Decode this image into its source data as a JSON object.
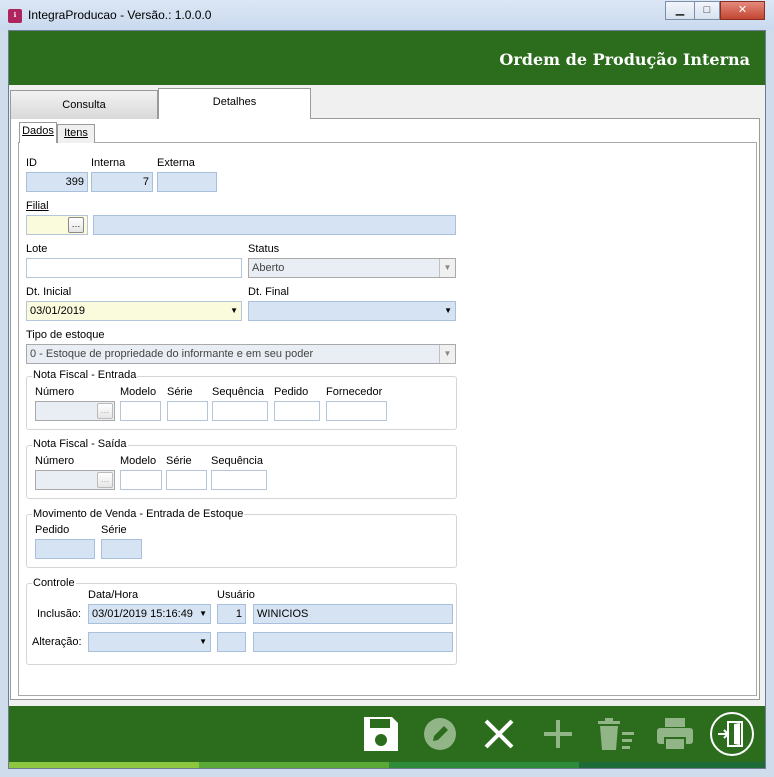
{
  "window": {
    "title": "IntegraProducao - Versão.: 1.0.0.0",
    "icon": "app-icon"
  },
  "header": {
    "title": "Ordem de Produção Interna"
  },
  "tabs": [
    {
      "label": "Consulta"
    },
    {
      "label": "Detalhes"
    }
  ],
  "subtabs": [
    {
      "label": "Dados"
    },
    {
      "label": "Itens"
    }
  ],
  "form": {
    "id_label": "ID",
    "id_value": "399",
    "interna_label": "Interna",
    "interna_value": "7",
    "externa_label": "Externa",
    "externa_value": "",
    "filial_label": "Filial",
    "filial_code": "",
    "filial_name": "",
    "lote_label": "Lote",
    "lote_value": "",
    "status_label": "Status",
    "status_value": "Aberto",
    "dt_inicial_label": "Dt. Inicial",
    "dt_inicial_value": "03/01/2019",
    "dt_final_label": "Dt. Final",
    "dt_final_value": "",
    "tipo_estoque_label": "Tipo de estoque",
    "tipo_estoque_value": "0 - Estoque de propriedade do informante e em seu poder"
  },
  "nf_entrada": {
    "title": "Nota Fiscal - Entrada",
    "labels": {
      "numero": "Número",
      "modelo": "Modelo",
      "serie": "Série",
      "sequencia": "Sequência",
      "pedido": "Pedido",
      "fornecedor": "Fornecedor"
    }
  },
  "nf_saida": {
    "title": "Nota Fiscal - Saída",
    "labels": {
      "numero": "Número",
      "modelo": "Modelo",
      "serie": "Série",
      "sequencia": "Sequência"
    }
  },
  "mov_venda": {
    "title": "Movimento de Venda - Entrada de Estoque",
    "labels": {
      "pedido": "Pedido",
      "serie": "Série"
    }
  },
  "controle": {
    "title": "Controle",
    "col_datahora": "Data/Hora",
    "col_usuario": "Usuário",
    "inclusao_label": "Inclusão:",
    "inclusao_datahora": "03/01/2019 15:16:49",
    "inclusao_user_id": "1",
    "inclusao_user_name": "WINICIOS",
    "alteracao_label": "Alteração:",
    "alteracao_datahora": "",
    "alteracao_user_id": "",
    "alteracao_user_name": ""
  },
  "toolbar": {
    "buttons": [
      "save-icon",
      "edit-icon",
      "cancel-icon",
      "add-icon",
      "delete-list-icon",
      "print-icon",
      "exit-icon"
    ]
  },
  "colors": {
    "header_green": "#2b6d1c",
    "field_blue": "#d6e3f2",
    "field_yellow": "#fafadc"
  }
}
